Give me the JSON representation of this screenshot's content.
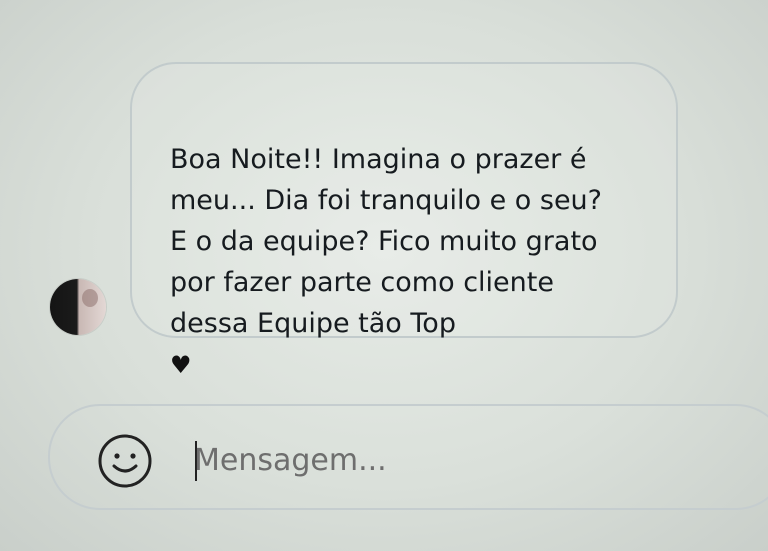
{
  "conversation": {
    "messages": [
      {
        "text": "Boa Noite!! Imagina o prazer é\nmeu... Dia foi tranquilo e o seu?\nE o da equipe? Fico muito grato\npor fazer parte como cliente\ndessa Equipe tão Top",
        "icon": "heart-icon"
      }
    ]
  },
  "composer": {
    "placeholder": "Mensagem...",
    "emoji_icon": "smiley-face-icon"
  },
  "colors": {
    "text": "#161b1f",
    "bubble_border": "#c2cbcc",
    "background": "#dfe4df",
    "placeholder": "#6e6e6e"
  }
}
